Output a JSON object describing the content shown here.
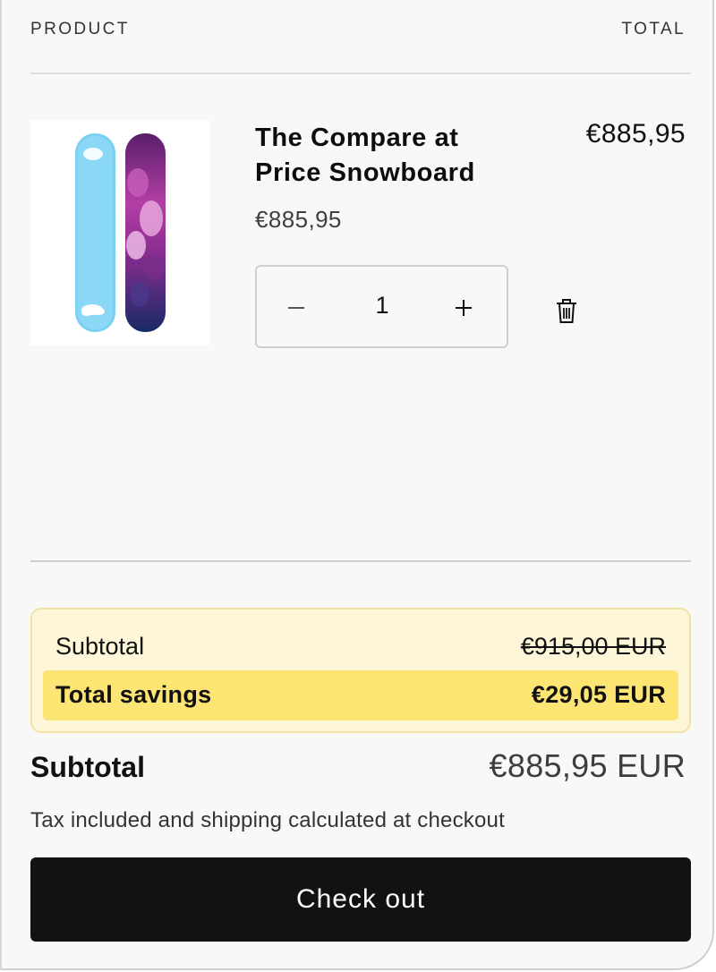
{
  "header": {
    "product_label": "PRODUCT",
    "total_label": "TOTAL"
  },
  "line_item": {
    "title": "The Compare at Price Snowboard",
    "price": "€885,95",
    "line_total": "€885,95",
    "quantity": "1",
    "image_icon": "snowboard-product-image",
    "minus_icon": "minus-icon",
    "plus_icon": "plus-icon",
    "remove_icon": "trash-icon"
  },
  "savings": {
    "subtotal_label": "Subtotal",
    "original_amount": "€915,00 EUR",
    "total_savings_label": "Total savings",
    "total_savings_value": "€29,05 EUR",
    "box_bg": "#fdf6d8",
    "highlight_bg": "#fde574"
  },
  "summary": {
    "subtotal_label": "Subtotal",
    "subtotal_value": "€885,95 EUR",
    "tax_note": "Tax included and shipping calculated at checkout"
  },
  "checkout": {
    "label": "Check out",
    "bg_color": "#121212"
  }
}
